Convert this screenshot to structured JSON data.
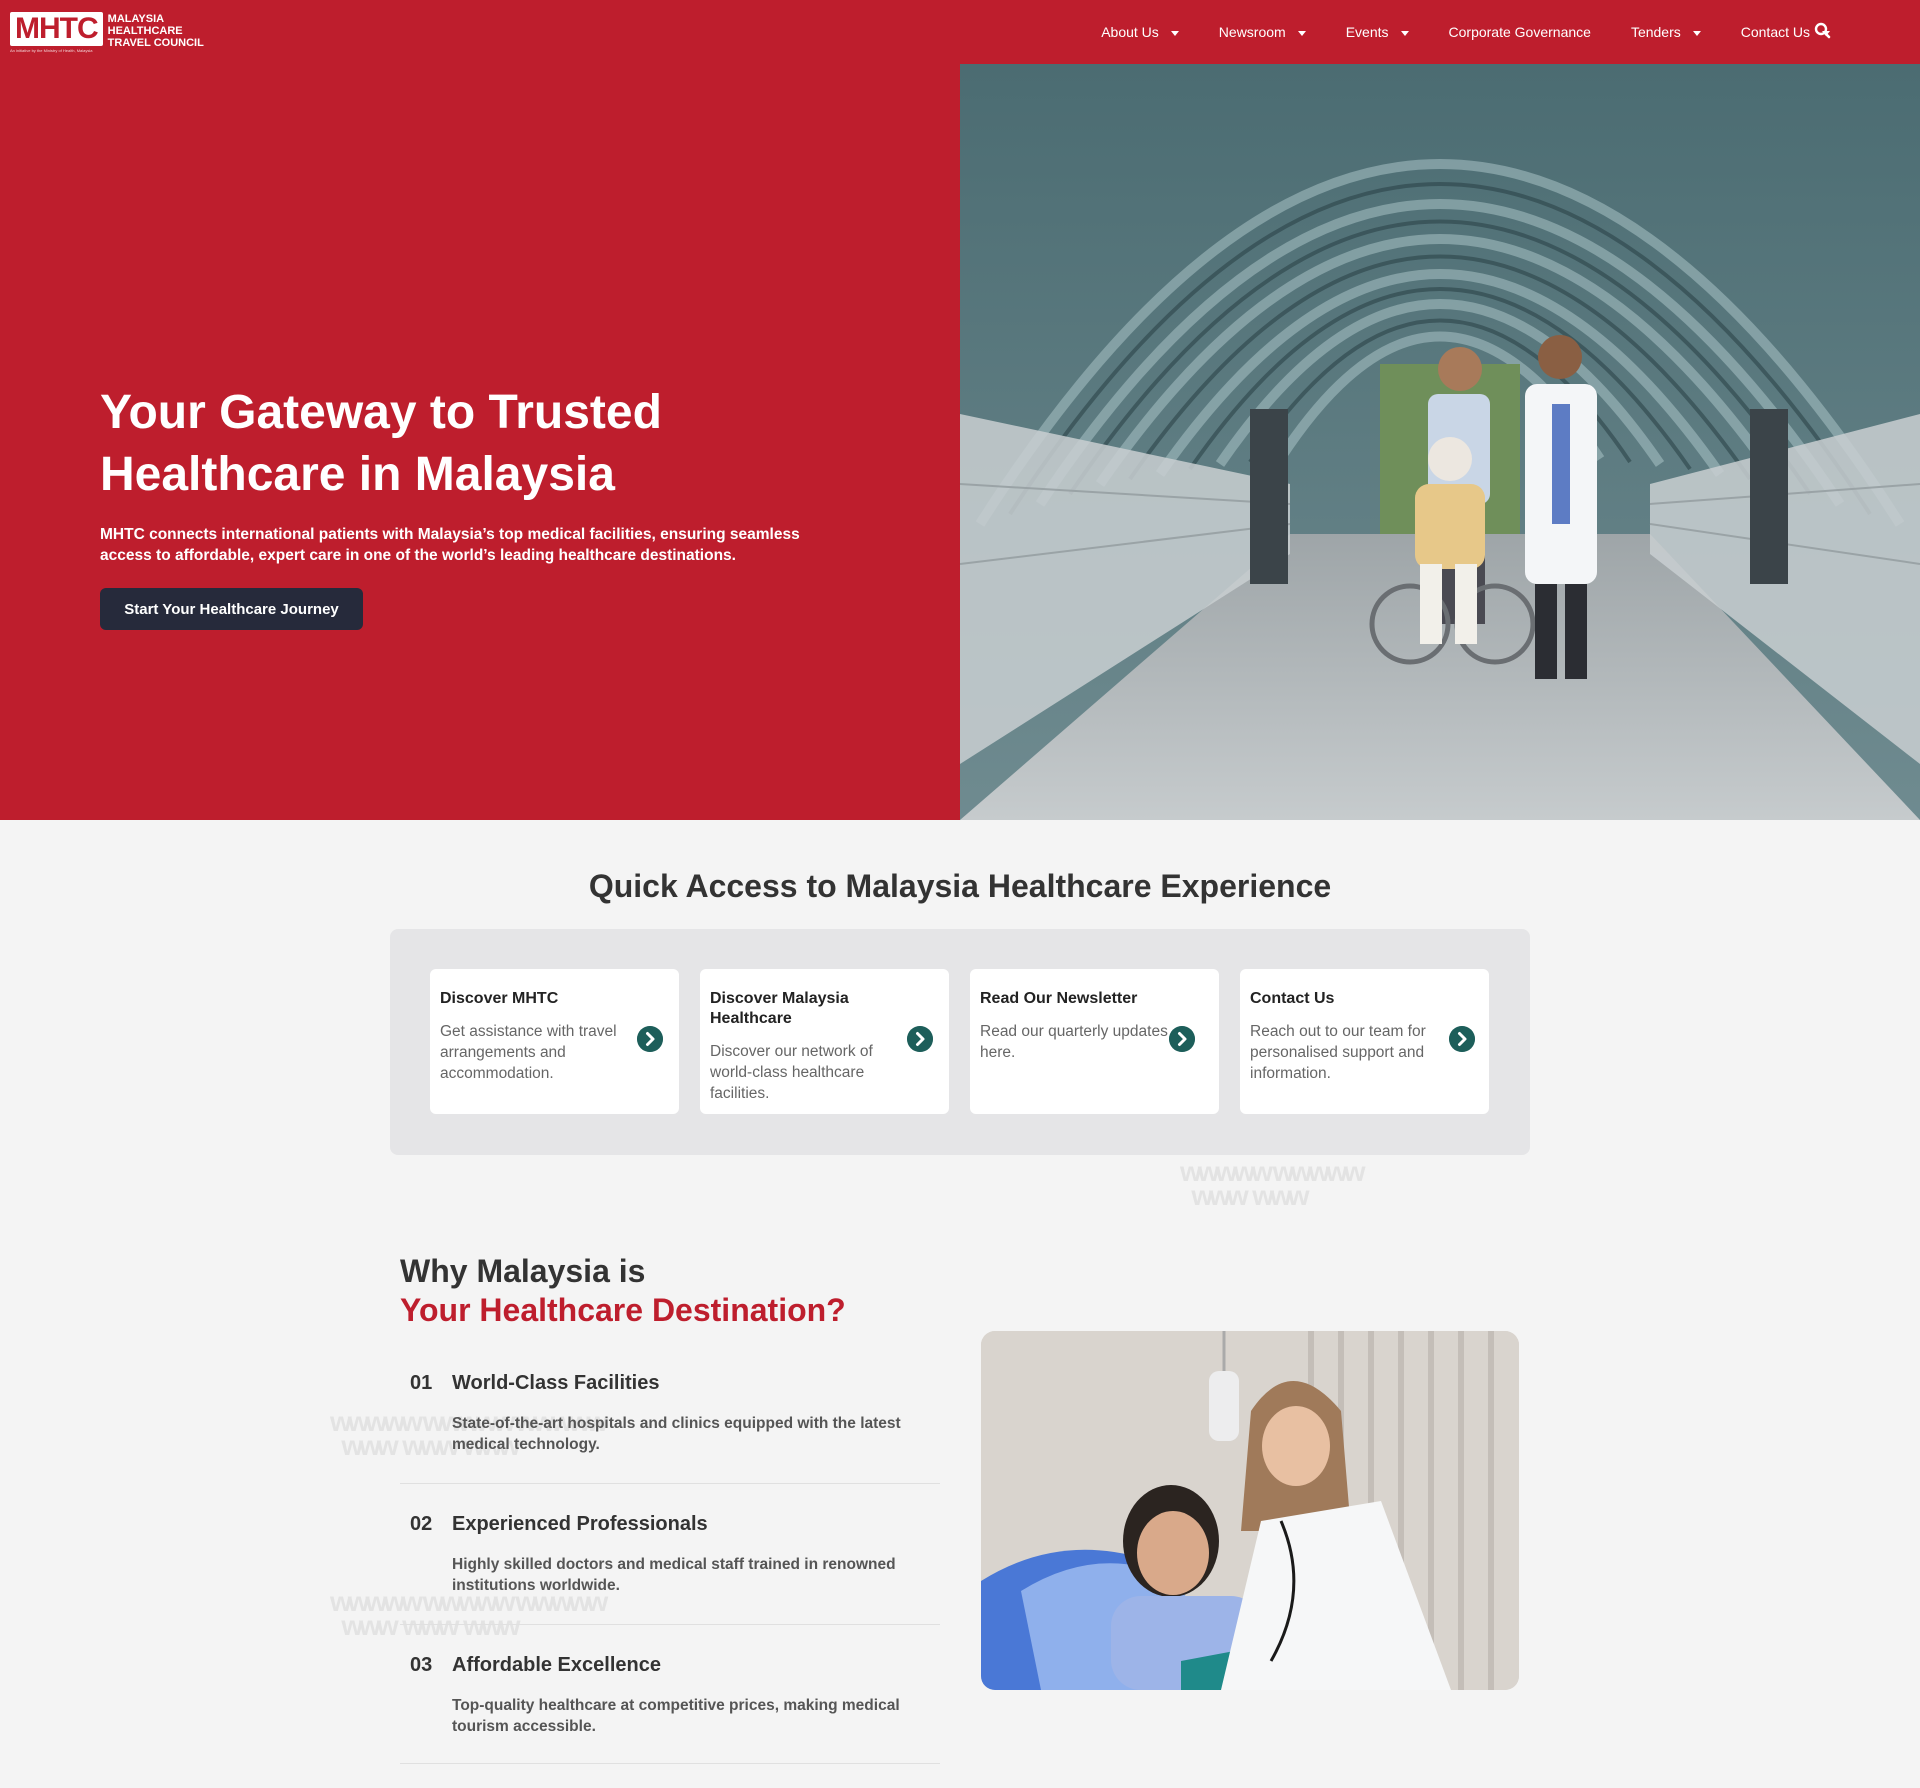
{
  "header": {
    "logo_mark": "MHTC",
    "logo_text_1": "MALAYSIA",
    "logo_text_2": "HEALTHCARE",
    "logo_text_3": "TRAVEL COUNCIL",
    "logo_sub": "An initiative by the Ministry of Health, Malaysia",
    "menu": [
      {
        "label": "About Us",
        "dropdown": true
      },
      {
        "label": "Newsroom",
        "dropdown": true
      },
      {
        "label": "Events",
        "dropdown": true
      },
      {
        "label": "Corporate Governance",
        "dropdown": false
      },
      {
        "label": "Tenders",
        "dropdown": true
      },
      {
        "label": "Contact Us",
        "dropdown": true
      }
    ],
    "search_icon": "search-icon"
  },
  "hero": {
    "title_line1": "Your Gateway to Trusted",
    "title_line2": "Healthcare in Malaysia",
    "description": "MHTC connects international patients with Malaysia’s top medical facilities, ensuring seamless access to affordable, expert care in one of the world’s leading healthcare destinations.",
    "cta": "Start Your Healthcare Journey"
  },
  "quick_access": {
    "title": "Quick Access to Malaysia Healthcare Experience",
    "cards": [
      {
        "title": "Discover MHTC",
        "description": "Get assistance with travel arrangements and accommodation.",
        "icon": "chevron-right-circle-icon"
      },
      {
        "title": "Discover Malaysia Healthcare",
        "description": "Discover our network of world-class healthcare facilities.",
        "icon": "chevron-right-circle-icon"
      },
      {
        "title": "Read Our Newsletter",
        "description": "Read our quarterly updates here.",
        "icon": "chevron-right-circle-icon"
      },
      {
        "title": "Contact Us",
        "description": "Reach out to our team for personalised support and information.",
        "icon": "chevron-right-circle-icon"
      }
    ]
  },
  "why": {
    "title_line1": "Why Malaysia is",
    "title_line2": "Your Healthcare Destination?",
    "features": [
      {
        "num": "01",
        "title": "World-Class Facilities",
        "description": "State-of-the-art hospitals and clinics equipped with the latest medical technology."
      },
      {
        "num": "02",
        "title": "Experienced Professionals",
        "description": "Highly skilled doctors and medical staff trained in renowned institutions worldwide."
      },
      {
        "num": "03",
        "title": "Affordable Excellence",
        "description": "Top-quality healthcare at competitive prices, making medical tourism accessible."
      }
    ]
  },
  "colors": {
    "brand_red": "#be1e2d",
    "button_dark": "#262a3b",
    "accent_teal": "#1d5e5a"
  }
}
